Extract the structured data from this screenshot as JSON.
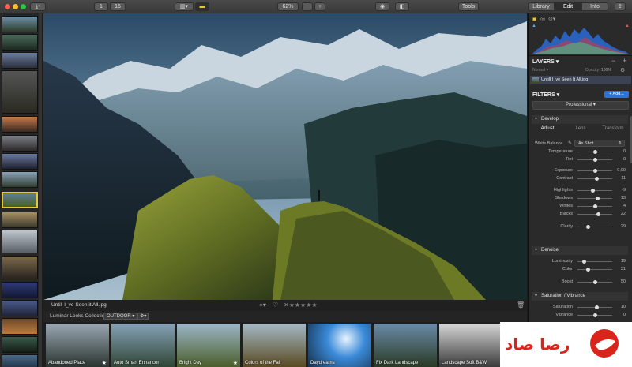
{
  "toolbar": {
    "export_icon": "download-icon",
    "btn_1": "1",
    "btn_16": "16",
    "zoom": "62%",
    "zoom_minus": "−",
    "zoom_plus": "+",
    "tools": "Tools",
    "tabs": [
      "Library",
      "Edit",
      "Info"
    ],
    "active_tab": "Edit"
  },
  "image": {
    "filename": "Untill I_ve Seen it All.jpg",
    "rating_stars": 0
  },
  "looks_bar": {
    "label": "Luminar Looks Collection:",
    "collection": "OUTDOOR"
  },
  "looks": [
    {
      "name": "Abandoned Place",
      "starred": true
    },
    {
      "name": "Auto Smart Enhancer",
      "starred": false
    },
    {
      "name": "Bright Day",
      "starred": true
    },
    {
      "name": "Colors of the Fall",
      "starred": false
    },
    {
      "name": "Daydreams",
      "starred": false
    },
    {
      "name": "Fix Dark Landscape",
      "starred": false
    },
    {
      "name": "Landscape Soft B&W",
      "starred": false
    }
  ],
  "layers": {
    "title": "LAYERS",
    "blend": "Normal",
    "opacity_label": "Opacity:",
    "opacity": "100%",
    "layer_name": "Untill I_ve Seen It All.jpg"
  },
  "filters": {
    "title": "FILTERS",
    "add": "+ Add...",
    "workspace": "Professional"
  },
  "develop": {
    "title": "Develop",
    "tabs": [
      "Adjust",
      "Lens",
      "Transform"
    ],
    "wb_label": "White Balance",
    "wb_value": "As Shot",
    "sliders": [
      {
        "label": "Temperature",
        "value": "0",
        "pos": 0.5
      },
      {
        "label": "Tint",
        "value": "0",
        "pos": 0.5
      },
      {
        "label": "Exposure",
        "value": "0.00",
        "pos": 0.5
      },
      {
        "label": "Contrast",
        "value": "11",
        "pos": 0.56
      },
      {
        "label": "Highlights",
        "value": "-9",
        "pos": 0.45
      },
      {
        "label": "Shadows",
        "value": "13",
        "pos": 0.57
      },
      {
        "label": "Whites",
        "value": "4",
        "pos": 0.52
      },
      {
        "label": "Blacks",
        "value": "22",
        "pos": 0.61
      },
      {
        "label": "Clarity",
        "value": "29",
        "pos": 0.3
      }
    ]
  },
  "denoise": {
    "title": "Denoise",
    "sliders": [
      {
        "label": "Luminosity",
        "value": "19",
        "pos": 0.19
      },
      {
        "label": "Color",
        "value": "31",
        "pos": 0.31
      },
      {
        "label": "Boost",
        "value": "50",
        "pos": 0.5
      }
    ]
  },
  "saturation": {
    "title": "Saturation / Vibrance",
    "sliders": [
      {
        "label": "Saturation",
        "value": "10",
        "pos": 0.55
      },
      {
        "label": "Vibrance",
        "value": "0",
        "pos": 0.5
      }
    ]
  },
  "watermark": {
    "text": "رضا صاد"
  }
}
